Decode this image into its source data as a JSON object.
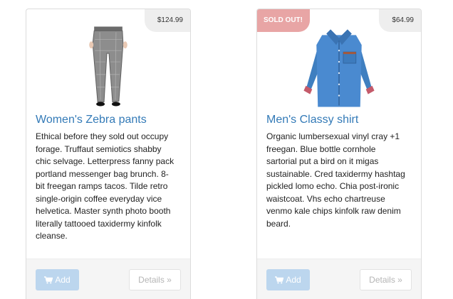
{
  "products": [
    {
      "name": "Women's Zebra pants",
      "price": "$124.99",
      "badge": "",
      "image_icon": "pants-photo",
      "description": "Ethical before they sold out occupy\nforage. Truffaut semiotics shabby\nchic selvage. Letterpress fanny pack\nportland messenger bag brunch. 8-\nbit freegan ramps tacos. Tilde retro\nsingle-origin coffee everyday vice\nhelvetica. Master synth photo booth\nliterally tattooed taxidermy kinfolk\ncleanse.",
      "add_label": "Add",
      "details_label": "Details »"
    },
    {
      "name": "Men's Classy shirt",
      "price": "$64.99",
      "badge": "SOLD OUT!",
      "image_icon": "shirt-photo",
      "description": "Organic lumbersexual vinyl cray +1\nfreegan. Blue bottle cornhole\nsartorial put a bird on it migas\nsustainable. Cred taxidermy hashtag\npickled lomo echo. Chia post-ironic\nwaistcoat. Vhs echo chartreuse\nvenmo kale chips kinfolk raw denim\nbeard.",
      "add_label": "Add",
      "details_label": "Details »"
    }
  ],
  "colors": {
    "title_link": "#337ab7",
    "add_button_disabled": "#bcd6ee",
    "sold_out_badge": "#e8a5a5",
    "price_tag": "#eeeeee",
    "footer_bg": "#f5f5f5"
  }
}
